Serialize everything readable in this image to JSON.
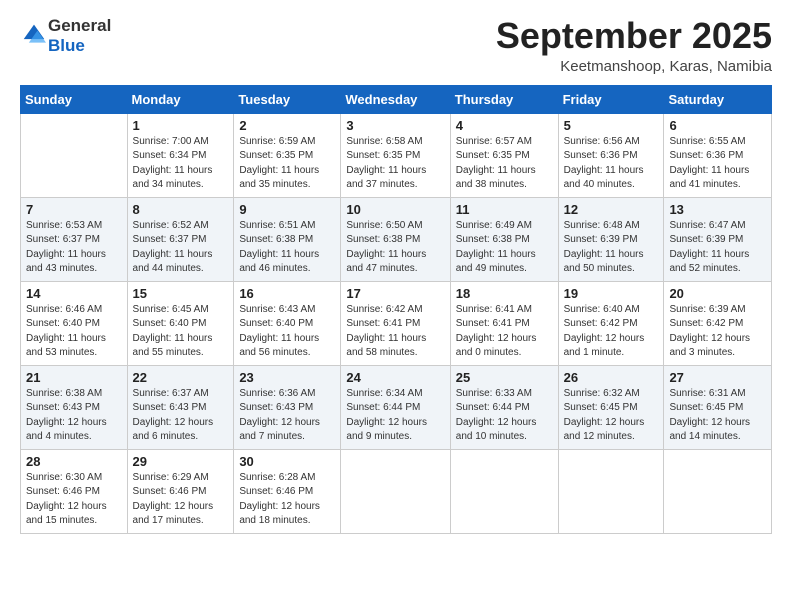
{
  "header": {
    "logo_general": "General",
    "logo_blue": "Blue",
    "month_title": "September 2025",
    "location": "Keetmanshoop, Karas, Namibia"
  },
  "weekdays": [
    "Sunday",
    "Monday",
    "Tuesday",
    "Wednesday",
    "Thursday",
    "Friday",
    "Saturday"
  ],
  "weeks": [
    [
      {
        "day": "",
        "sunrise": "",
        "sunset": "",
        "daylight": ""
      },
      {
        "day": "1",
        "sunrise": "Sunrise: 7:00 AM",
        "sunset": "Sunset: 6:34 PM",
        "daylight": "Daylight: 11 hours and 34 minutes."
      },
      {
        "day": "2",
        "sunrise": "Sunrise: 6:59 AM",
        "sunset": "Sunset: 6:35 PM",
        "daylight": "Daylight: 11 hours and 35 minutes."
      },
      {
        "day": "3",
        "sunrise": "Sunrise: 6:58 AM",
        "sunset": "Sunset: 6:35 PM",
        "daylight": "Daylight: 11 hours and 37 minutes."
      },
      {
        "day": "4",
        "sunrise": "Sunrise: 6:57 AM",
        "sunset": "Sunset: 6:35 PM",
        "daylight": "Daylight: 11 hours and 38 minutes."
      },
      {
        "day": "5",
        "sunrise": "Sunrise: 6:56 AM",
        "sunset": "Sunset: 6:36 PM",
        "daylight": "Daylight: 11 hours and 40 minutes."
      },
      {
        "day": "6",
        "sunrise": "Sunrise: 6:55 AM",
        "sunset": "Sunset: 6:36 PM",
        "daylight": "Daylight: 11 hours and 41 minutes."
      }
    ],
    [
      {
        "day": "7",
        "sunrise": "Sunrise: 6:53 AM",
        "sunset": "Sunset: 6:37 PM",
        "daylight": "Daylight: 11 hours and 43 minutes."
      },
      {
        "day": "8",
        "sunrise": "Sunrise: 6:52 AM",
        "sunset": "Sunset: 6:37 PM",
        "daylight": "Daylight: 11 hours and 44 minutes."
      },
      {
        "day": "9",
        "sunrise": "Sunrise: 6:51 AM",
        "sunset": "Sunset: 6:38 PM",
        "daylight": "Daylight: 11 hours and 46 minutes."
      },
      {
        "day": "10",
        "sunrise": "Sunrise: 6:50 AM",
        "sunset": "Sunset: 6:38 PM",
        "daylight": "Daylight: 11 hours and 47 minutes."
      },
      {
        "day": "11",
        "sunrise": "Sunrise: 6:49 AM",
        "sunset": "Sunset: 6:38 PM",
        "daylight": "Daylight: 11 hours and 49 minutes."
      },
      {
        "day": "12",
        "sunrise": "Sunrise: 6:48 AM",
        "sunset": "Sunset: 6:39 PM",
        "daylight": "Daylight: 11 hours and 50 minutes."
      },
      {
        "day": "13",
        "sunrise": "Sunrise: 6:47 AM",
        "sunset": "Sunset: 6:39 PM",
        "daylight": "Daylight: 11 hours and 52 minutes."
      }
    ],
    [
      {
        "day": "14",
        "sunrise": "Sunrise: 6:46 AM",
        "sunset": "Sunset: 6:40 PM",
        "daylight": "Daylight: 11 hours and 53 minutes."
      },
      {
        "day": "15",
        "sunrise": "Sunrise: 6:45 AM",
        "sunset": "Sunset: 6:40 PM",
        "daylight": "Daylight: 11 hours and 55 minutes."
      },
      {
        "day": "16",
        "sunrise": "Sunrise: 6:43 AM",
        "sunset": "Sunset: 6:40 PM",
        "daylight": "Daylight: 11 hours and 56 minutes."
      },
      {
        "day": "17",
        "sunrise": "Sunrise: 6:42 AM",
        "sunset": "Sunset: 6:41 PM",
        "daylight": "Daylight: 11 hours and 58 minutes."
      },
      {
        "day": "18",
        "sunrise": "Sunrise: 6:41 AM",
        "sunset": "Sunset: 6:41 PM",
        "daylight": "Daylight: 12 hours and 0 minutes."
      },
      {
        "day": "19",
        "sunrise": "Sunrise: 6:40 AM",
        "sunset": "Sunset: 6:42 PM",
        "daylight": "Daylight: 12 hours and 1 minute."
      },
      {
        "day": "20",
        "sunrise": "Sunrise: 6:39 AM",
        "sunset": "Sunset: 6:42 PM",
        "daylight": "Daylight: 12 hours and 3 minutes."
      }
    ],
    [
      {
        "day": "21",
        "sunrise": "Sunrise: 6:38 AM",
        "sunset": "Sunset: 6:43 PM",
        "daylight": "Daylight: 12 hours and 4 minutes."
      },
      {
        "day": "22",
        "sunrise": "Sunrise: 6:37 AM",
        "sunset": "Sunset: 6:43 PM",
        "daylight": "Daylight: 12 hours and 6 minutes."
      },
      {
        "day": "23",
        "sunrise": "Sunrise: 6:36 AM",
        "sunset": "Sunset: 6:43 PM",
        "daylight": "Daylight: 12 hours and 7 minutes."
      },
      {
        "day": "24",
        "sunrise": "Sunrise: 6:34 AM",
        "sunset": "Sunset: 6:44 PM",
        "daylight": "Daylight: 12 hours and 9 minutes."
      },
      {
        "day": "25",
        "sunrise": "Sunrise: 6:33 AM",
        "sunset": "Sunset: 6:44 PM",
        "daylight": "Daylight: 12 hours and 10 minutes."
      },
      {
        "day": "26",
        "sunrise": "Sunrise: 6:32 AM",
        "sunset": "Sunset: 6:45 PM",
        "daylight": "Daylight: 12 hours and 12 minutes."
      },
      {
        "day": "27",
        "sunrise": "Sunrise: 6:31 AM",
        "sunset": "Sunset: 6:45 PM",
        "daylight": "Daylight: 12 hours and 14 minutes."
      }
    ],
    [
      {
        "day": "28",
        "sunrise": "Sunrise: 6:30 AM",
        "sunset": "Sunset: 6:46 PM",
        "daylight": "Daylight: 12 hours and 15 minutes."
      },
      {
        "day": "29",
        "sunrise": "Sunrise: 6:29 AM",
        "sunset": "Sunset: 6:46 PM",
        "daylight": "Daylight: 12 hours and 17 minutes."
      },
      {
        "day": "30",
        "sunrise": "Sunrise: 6:28 AM",
        "sunset": "Sunset: 6:46 PM",
        "daylight": "Daylight: 12 hours and 18 minutes."
      },
      {
        "day": "",
        "sunrise": "",
        "sunset": "",
        "daylight": ""
      },
      {
        "day": "",
        "sunrise": "",
        "sunset": "",
        "daylight": ""
      },
      {
        "day": "",
        "sunrise": "",
        "sunset": "",
        "daylight": ""
      },
      {
        "day": "",
        "sunrise": "",
        "sunset": "",
        "daylight": ""
      }
    ]
  ]
}
